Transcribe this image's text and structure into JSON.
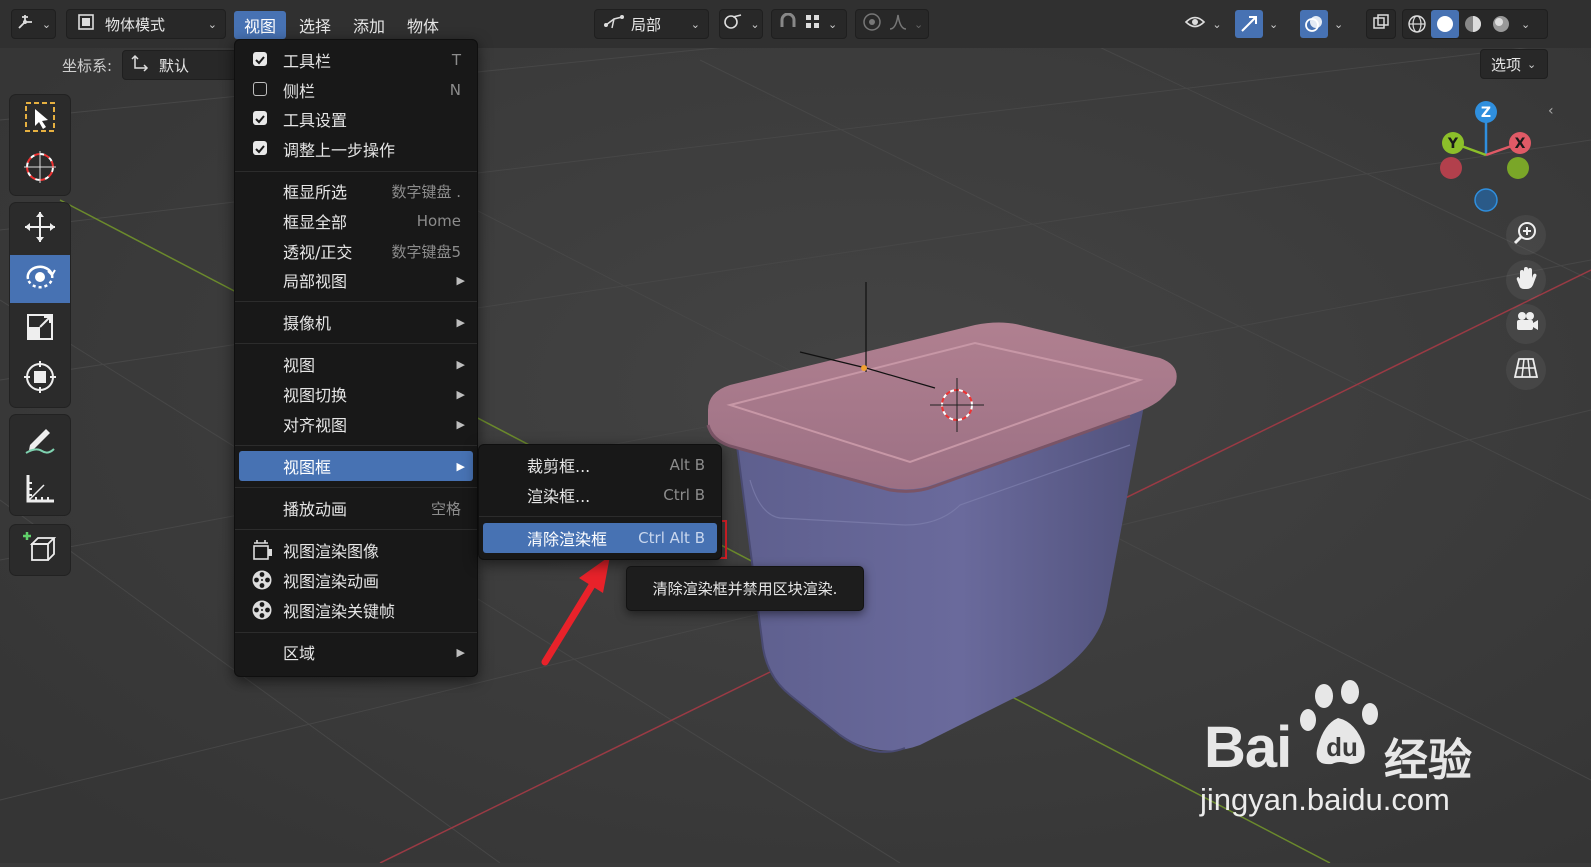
{
  "header": {
    "mode_label": "物体模式",
    "menus": [
      "视图",
      "选择",
      "添加",
      "物体"
    ],
    "pivot_label": "局部",
    "options_label": "选项"
  },
  "subheader": {
    "coord_label": "坐标系:",
    "coord_value": "默认"
  },
  "view_menu": {
    "items": [
      {
        "label": "工具栏",
        "shortcut": "T",
        "checked": true
      },
      {
        "label": "侧栏",
        "shortcut": "N",
        "checked": false
      },
      {
        "label": "工具设置",
        "shortcut": "",
        "checked": true
      },
      {
        "label": "调整上一步操作",
        "shortcut": "",
        "checked": true
      },
      {
        "label": "框显所选",
        "shortcut": "数字键盘 ."
      },
      {
        "label": "框显全部",
        "shortcut": "Home"
      },
      {
        "label": "透视/正交",
        "shortcut": "数字键盘5"
      },
      {
        "label": "局部视图",
        "submenu": true
      },
      {
        "label": "摄像机",
        "submenu": true
      },
      {
        "label": "视图",
        "submenu": true
      },
      {
        "label": "视图切换",
        "submenu": true
      },
      {
        "label": "对齐视图",
        "submenu": true
      },
      {
        "label": "视图框",
        "submenu": true,
        "highlighted": true
      },
      {
        "label": "播放动画",
        "shortcut": "空格"
      },
      {
        "label": "视图渲染图像",
        "icon": "render-image-icon"
      },
      {
        "label": "视图渲染动画",
        "icon": "film-reel-icon"
      },
      {
        "label": "视图渲染关键帧",
        "icon": "film-reel-icon"
      },
      {
        "label": "区域",
        "submenu": true
      }
    ]
  },
  "viewbox_submenu": {
    "items": [
      {
        "label": "裁剪框...",
        "shortcut": "Alt B"
      },
      {
        "label": "渲染框...",
        "shortcut": "Ctrl B"
      },
      {
        "label": "清除渲染框",
        "shortcut": "Ctrl Alt B",
        "highlighted": true
      }
    ]
  },
  "tooltip": {
    "text": "清除渲染框并禁用区块渲染."
  },
  "gizmo": {
    "z": "Z",
    "y": "Y",
    "x": "X"
  },
  "watermark": {
    "brand": "Bai",
    "brand_cn": "经验",
    "url": "jingyan.baidu.com"
  },
  "colors": {
    "accent": "#4772b3",
    "menu_bg": "#181818",
    "viewport_bg": "#3a3a3a",
    "annotation_red": "#e8222a",
    "axis_x": "#e05a66",
    "axis_y": "#8cbf2a",
    "axis_z": "#2f8fde"
  }
}
